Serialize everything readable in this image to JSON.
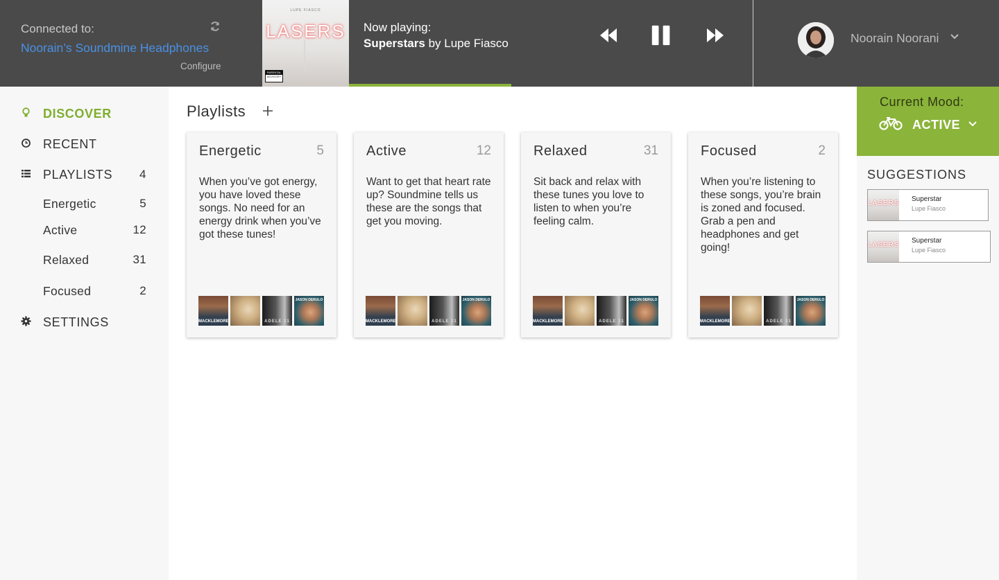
{
  "connection": {
    "label": "Connected to:",
    "device": "Noorain’s Soundmine Headphones",
    "configure": "Configure"
  },
  "album": {
    "title": "LASERS",
    "artist_small": "LUPE FIASCO"
  },
  "now_playing": {
    "label": "Now playing:",
    "track": "Superstars",
    "by": "by Lupe Fiasco",
    "progress": 0.22
  },
  "controls": {
    "prev_icon": "rewind-icon",
    "pause_icon": "pause-icon",
    "next_icon": "fast-forward-icon"
  },
  "user": {
    "name": "Noorain Noorani"
  },
  "sidebar": {
    "discover": "DISCOVER",
    "recent": "RECENT",
    "playlists": "PLAYLISTS",
    "playlists_count": "4",
    "settings": "SETTINGS",
    "sub_items": [
      {
        "label": "Energetic",
        "count": "5"
      },
      {
        "label": "Active",
        "count": "12"
      },
      {
        "label": "Relaxed",
        "count": "31"
      },
      {
        "label": "Focused",
        "count": "2"
      }
    ]
  },
  "main": {
    "title": "Playlists",
    "cards": [
      {
        "title": "Energetic",
        "count": "5",
        "description": "When you’ve got energy, you have loved these songs. No need for an energy drink when you’ve got these tunes!"
      },
      {
        "title": "Active",
        "count": "12",
        "description": "Want to get that heart rate up? Soundmine tells us these are the songs that get you moving."
      },
      {
        "title": "Relaxed",
        "count": "31",
        "description": "Sit back and relax with these tunes you love to listen to when you’re feeling calm."
      },
      {
        "title": "Focused",
        "count": "2",
        "description": "When you’re listening to these songs, you’re brain is zoned and focused. Grab a pen and headphones and get going!"
      }
    ],
    "thumb_texts": {
      "t1": "MACKLEMORE",
      "t3": "ADELE 21",
      "t4": "JASON DERULO"
    }
  },
  "mood": {
    "label": "Current Mood:",
    "value": "ACTIVE",
    "icon": "bicycle-icon",
    "accent": "#8bb43a"
  },
  "suggestions": {
    "title": "SUGGESTIONS",
    "items": [
      {
        "title": "Superstar",
        "artist": "Lupe Fiasco"
      },
      {
        "title": "Superstar",
        "artist": "Lupe Fiasco"
      }
    ]
  },
  "colors": {
    "topbar": "#4a4a4a",
    "accent_green": "#8bb43a",
    "link_blue": "#4a90e2",
    "sidebar_bg": "#f7f7f7"
  }
}
